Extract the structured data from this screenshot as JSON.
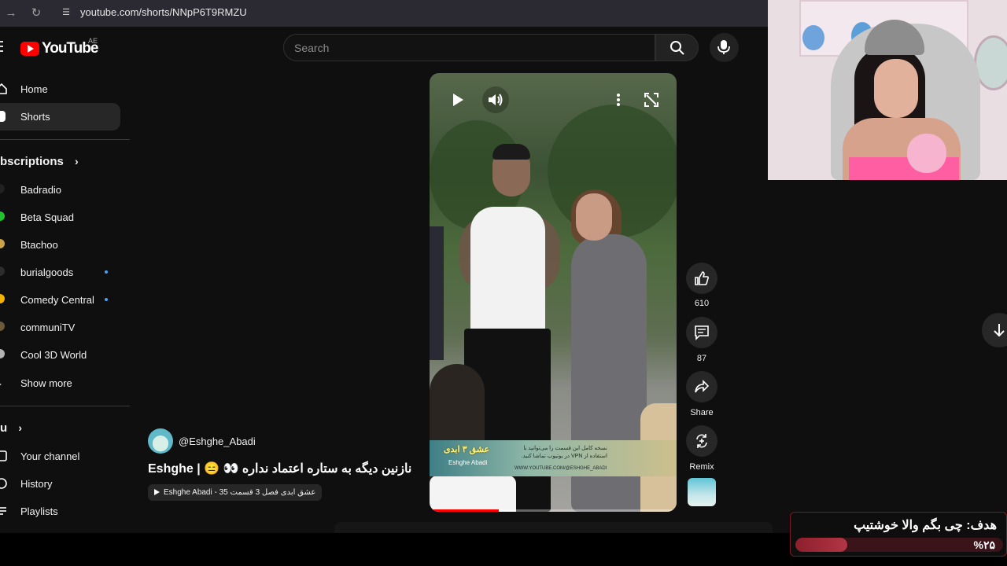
{
  "browser": {
    "url": "youtube.com/shorts/NNpP6T9RMZU"
  },
  "header": {
    "logo_text": "YouTube",
    "region": "AE",
    "search_placeholder": "Search"
  },
  "sidebar": {
    "main_items": [
      {
        "label": "Home",
        "icon": "home-icon"
      },
      {
        "label": "Shorts",
        "icon": "shorts-icon",
        "active": true
      }
    ],
    "subscriptions_title": "bscriptions",
    "subscriptions": [
      {
        "label": "Badradio",
        "color": "#222222",
        "new": false
      },
      {
        "label": "Beta Squad",
        "color": "#22c22e",
        "new": false
      },
      {
        "label": "Btachoo",
        "color": "#c9a24a",
        "new": false
      },
      {
        "label": "burialgoods",
        "color": "#2d2d2d",
        "new": true
      },
      {
        "label": "Comedy Central",
        "color": "#f2b400",
        "new": true
      },
      {
        "label": "communiTV",
        "color": "#6b5a3a",
        "new": false
      },
      {
        "label": "Cool 3D World",
        "color": "#b3b3b3",
        "new": false
      }
    ],
    "show_more": "Show more",
    "you_title": "u",
    "you_items": [
      {
        "label": "Your channel",
        "icon": "channel-icon"
      },
      {
        "label": "History",
        "icon": "history-icon"
      },
      {
        "label": "Playlists",
        "icon": "playlists-icon"
      }
    ]
  },
  "video": {
    "banner_logo": "عشق ۳ ابدی",
    "banner_logo_sub": "Eshghe Abadi",
    "banner_text": "نسخه کامل این قسمت را می‌توانید با استفاده از VPN در یوتیوب تماشا کنید.",
    "banner_url": "WWW.YOUTUBE.COM/@ESHGHE_ABADI",
    "progress": 0.28
  },
  "actions": {
    "likes": "610",
    "comments": "87",
    "share": "Share",
    "remix": "Remix"
  },
  "channel": {
    "handle": "@Eshghe_Abadi",
    "title": "Eshghe | 😑 👀 نازنین دیگه به ستاره اعتماد نداره ...",
    "playlist": "Eshghe Abadi - عشق ابدی فصل 3 قسمت 35"
  },
  "goal": {
    "title": "هدف: چی بگم والا خوشتیپ",
    "percent_label": "%۲۵",
    "percent": 25,
    "accent": "#b23545"
  }
}
